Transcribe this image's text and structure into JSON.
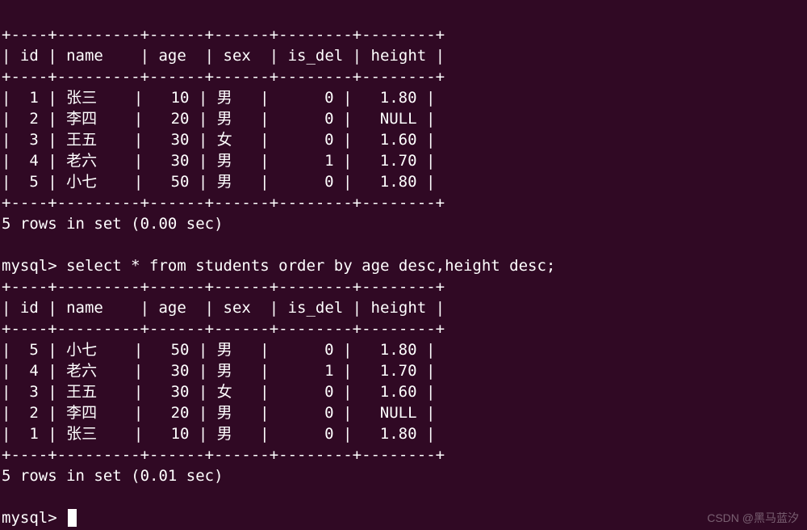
{
  "result1": {
    "headers": [
      "id",
      "name",
      "age",
      "sex",
      "is_del",
      "height"
    ],
    "rows": [
      {
        "id": 1,
        "name": "张三",
        "age": 10,
        "sex": "男",
        "is_del": 0,
        "height": "1.80"
      },
      {
        "id": 2,
        "name": "李四",
        "age": 20,
        "sex": "男",
        "is_del": 0,
        "height": "NULL"
      },
      {
        "id": 3,
        "name": "王五",
        "age": 30,
        "sex": "女",
        "is_del": 0,
        "height": "1.60"
      },
      {
        "id": 4,
        "name": "老六",
        "age": 30,
        "sex": "男",
        "is_del": 1,
        "height": "1.70"
      },
      {
        "id": 5,
        "name": "小七",
        "age": 50,
        "sex": "男",
        "is_del": 0,
        "height": "1.80"
      }
    ],
    "status": "5 rows in set (0.00 sec)"
  },
  "prompt1": "mysql> ",
  "query": "select * from students order by age desc,height desc;",
  "result2": {
    "headers": [
      "id",
      "name",
      "age",
      "sex",
      "is_del",
      "height"
    ],
    "rows": [
      {
        "id": 5,
        "name": "小七",
        "age": 50,
        "sex": "男",
        "is_del": 0,
        "height": "1.80"
      },
      {
        "id": 4,
        "name": "老六",
        "age": 30,
        "sex": "男",
        "is_del": 1,
        "height": "1.70"
      },
      {
        "id": 3,
        "name": "王五",
        "age": 30,
        "sex": "女",
        "is_del": 0,
        "height": "1.60"
      },
      {
        "id": 2,
        "name": "李四",
        "age": 20,
        "sex": "男",
        "is_del": 0,
        "height": "NULL"
      },
      {
        "id": 1,
        "name": "张三",
        "age": 10,
        "sex": "男",
        "is_del": 0,
        "height": "1.80"
      }
    ],
    "status": "5 rows in set (0.01 sec)"
  },
  "prompt2": "mysql> ",
  "watermark": "CSDN @黑马蓝汐",
  "chart_data": {
    "type": "table",
    "title": "MySQL students table — two result sets",
    "columns": [
      "id",
      "name",
      "age",
      "sex",
      "is_del",
      "height"
    ],
    "set1": [
      [
        1,
        "张三",
        10,
        "男",
        0,
        1.8
      ],
      [
        2,
        "李四",
        20,
        "男",
        0,
        null
      ],
      [
        3,
        "王五",
        30,
        "女",
        0,
        1.6
      ],
      [
        4,
        "老六",
        30,
        "男",
        1,
        1.7
      ],
      [
        5,
        "小七",
        50,
        "男",
        0,
        1.8
      ]
    ],
    "query": "select * from students order by age desc,height desc;",
    "set2": [
      [
        5,
        "小七",
        50,
        "男",
        0,
        1.8
      ],
      [
        4,
        "老六",
        30,
        "男",
        1,
        1.7
      ],
      [
        3,
        "王五",
        30,
        "女",
        0,
        1.6
      ],
      [
        2,
        "李四",
        20,
        "男",
        0,
        null
      ],
      [
        1,
        "张三",
        10,
        "男",
        0,
        1.8
      ]
    ]
  }
}
